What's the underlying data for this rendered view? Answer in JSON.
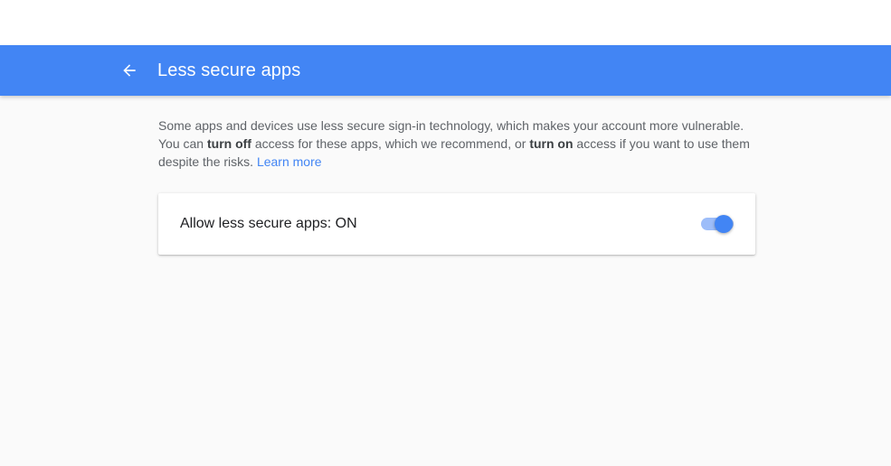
{
  "header": {
    "title": "Less secure apps",
    "back_icon": "arrow-back-icon",
    "bar_color": "#4285f4"
  },
  "description": {
    "part1": "Some apps and devices use less secure sign-in technology, which makes your account more vulnerable. You can ",
    "bold1": "turn off",
    "part2": " access for these apps, which we recommend, or ",
    "bold2": "turn on",
    "part3": " access if you want to use them despite the risks. ",
    "link": "Learn more"
  },
  "setting": {
    "label": "Allow less secure apps: ON",
    "enabled": true,
    "accent_color": "#4285f4"
  }
}
